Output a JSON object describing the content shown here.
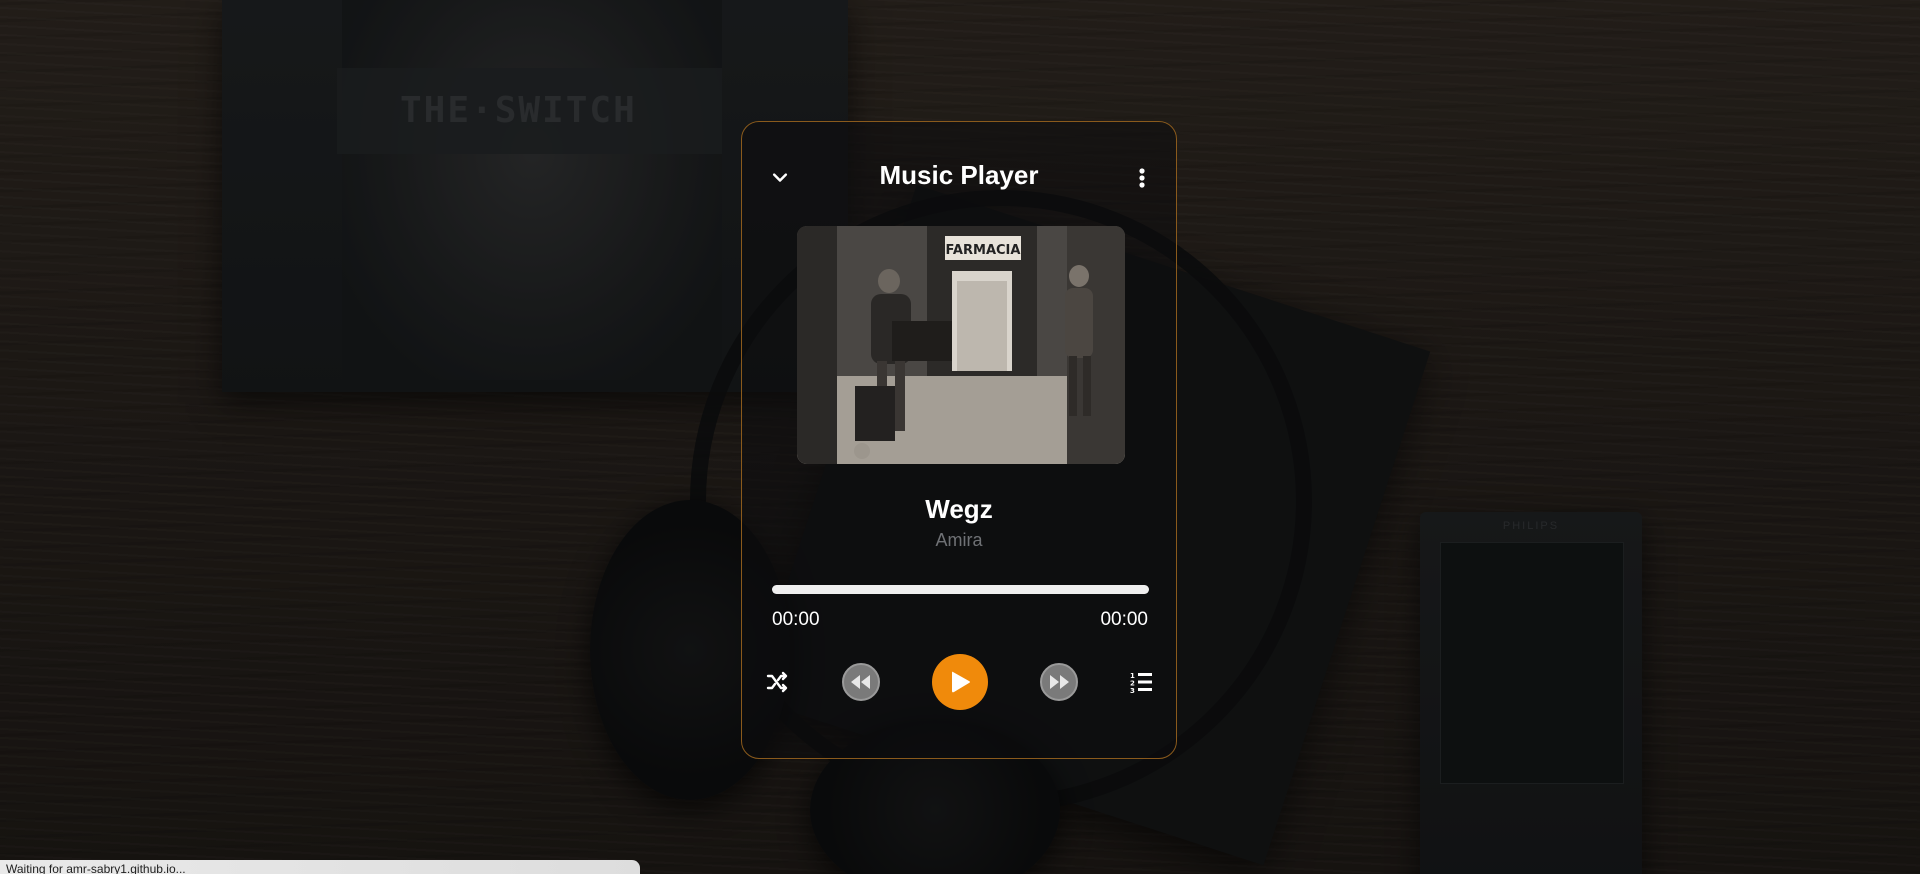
{
  "background": {
    "album_brand": "THE·SWITCH",
    "device_brand": "PHILIPS"
  },
  "player": {
    "title": "Music Player",
    "song_title": "Wegz",
    "artist": "Amira",
    "cover_sign": "FARMACIA",
    "time_current": "00:00",
    "time_total": "00:00",
    "progress": 0,
    "accent_color": "#f08a0b",
    "icons": {
      "collapse": "chevron-down-icon",
      "menu": "more-vertical-icon",
      "shuffle": "shuffle-icon",
      "rewind": "rewind-icon",
      "play": "play-icon",
      "forward": "fast-forward-icon",
      "playlist": "playlist-icon"
    }
  },
  "status_bar": {
    "text": "Waiting for amr-sabry1.github.io..."
  }
}
